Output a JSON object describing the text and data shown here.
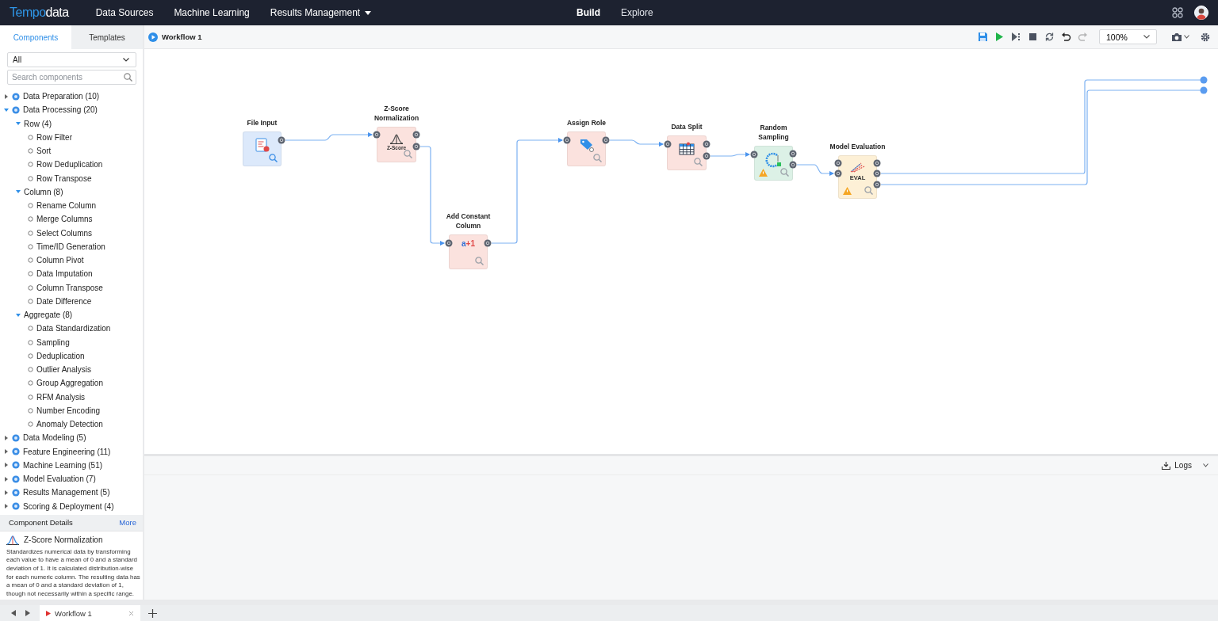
{
  "topbar": {
    "logo": {
      "part_1": "Tempo",
      "part_2": "data"
    },
    "nav": [
      {
        "label": "Data Sources",
        "dropdown": false
      },
      {
        "label": "Machine Learning",
        "dropdown": false
      },
      {
        "label": "Results Management",
        "dropdown": true
      }
    ],
    "modes": [
      {
        "label": "Build",
        "selected": true
      },
      {
        "label": "Explore",
        "selected": false
      }
    ]
  },
  "sidebar": {
    "tabs": [
      {
        "label": "Components",
        "selected": true
      },
      {
        "label": "Templates",
        "selected": false
      }
    ],
    "filter": "All",
    "search": {
      "placeholder": "Search components"
    },
    "tree": [
      {
        "label": "Data Preparation (10)",
        "expanded": false
      },
      {
        "label": "Data Processing (20)",
        "expanded": true,
        "children": [
          {
            "label": "Row (4)",
            "expanded": true,
            "children": [
              {
                "label": "Row Filter"
              },
              {
                "label": "Sort"
              },
              {
                "label": "Row Deduplication"
              },
              {
                "label": "Row Transpose"
              }
            ]
          },
          {
            "label": "Column (8)",
            "expanded": true,
            "children": [
              {
                "label": "Rename Column"
              },
              {
                "label": "Merge Columns"
              },
              {
                "label": "Select Columns"
              },
              {
                "label": "Time/ID Generation"
              },
              {
                "label": "Column Pivot"
              },
              {
                "label": "Data Imputation"
              },
              {
                "label": "Column Transpose"
              },
              {
                "label": "Date Difference"
              }
            ]
          },
          {
            "label": "Aggregate (8)",
            "expanded": true,
            "children": [
              {
                "label": "Data Standardization"
              },
              {
                "label": "Sampling"
              },
              {
                "label": "Deduplication"
              },
              {
                "label": "Outlier Analysis"
              },
              {
                "label": "Group Aggregation"
              },
              {
                "label": "RFM Analysis"
              },
              {
                "label": "Number Encoding"
              },
              {
                "label": "Anomaly Detection"
              }
            ]
          }
        ]
      },
      {
        "label": "Data Modeling (5)",
        "expanded": false
      },
      {
        "label": "Feature Engineering (11)",
        "expanded": false
      },
      {
        "label": "Machine Learning (51)",
        "expanded": false
      },
      {
        "label": "Model Evaluation (7)",
        "expanded": false
      },
      {
        "label": "Results Management (5)",
        "expanded": false
      },
      {
        "label": "Scoring & Deployment (4)",
        "expanded": false
      }
    ],
    "details": {
      "title": "Component Details",
      "more": "More",
      "name": "Z-Score Normalization",
      "description": "Standardizes numerical data by transforming each value to have a mean of 0 and a standard deviation of 1. It is calculated distribution-wise for each numeric column. The resulting data has a mean of 0 and a standard deviation of 1, though not necessarily within a specific range."
    }
  },
  "workflow": {
    "title": "Workflow 1",
    "tools": [
      {
        "kind": "save",
        "disabled": false
      },
      {
        "kind": "run",
        "disabled": false
      },
      {
        "kind": "step",
        "disabled": false
      },
      {
        "kind": "stop",
        "disabled": false
      },
      {
        "kind": "refresh",
        "disabled": false
      },
      {
        "kind": "undo",
        "disabled": false
      },
      {
        "kind": "redo",
        "disabled": true
      }
    ],
    "zoom": "100%",
    "nodes": [
      {
        "label": "File Input",
        "kind": "file",
        "color": "#dce9fb",
        "warning": false
      },
      {
        "label": "Z-Score Normalization",
        "kind": "zscore",
        "icon_text": "Z-Score",
        "color": "#fbe2de",
        "warning": false
      },
      {
        "label": "Add Constant Column",
        "kind": "constant",
        "icon_text": "a+1",
        "color": "#fbe2de",
        "warning": false
      },
      {
        "label": "Assign Role",
        "kind": "role",
        "color": "#fbe2de",
        "warning": false
      },
      {
        "label": "Data Split",
        "kind": "split",
        "color": "#fbe2de",
        "warning": false
      },
      {
        "label": "Random Sampling",
        "kind": "sampling",
        "color": "#dcf1e6",
        "warning": true
      },
      {
        "label": "Model Evaluation",
        "kind": "eval",
        "icon_text": "EVAL",
        "color": "#fdf0d6",
        "warning": true
      }
    ],
    "logs": "Logs"
  },
  "bottom": {
    "tabs": [
      {
        "label": "Workflow 1",
        "selected": true
      }
    ]
  }
}
